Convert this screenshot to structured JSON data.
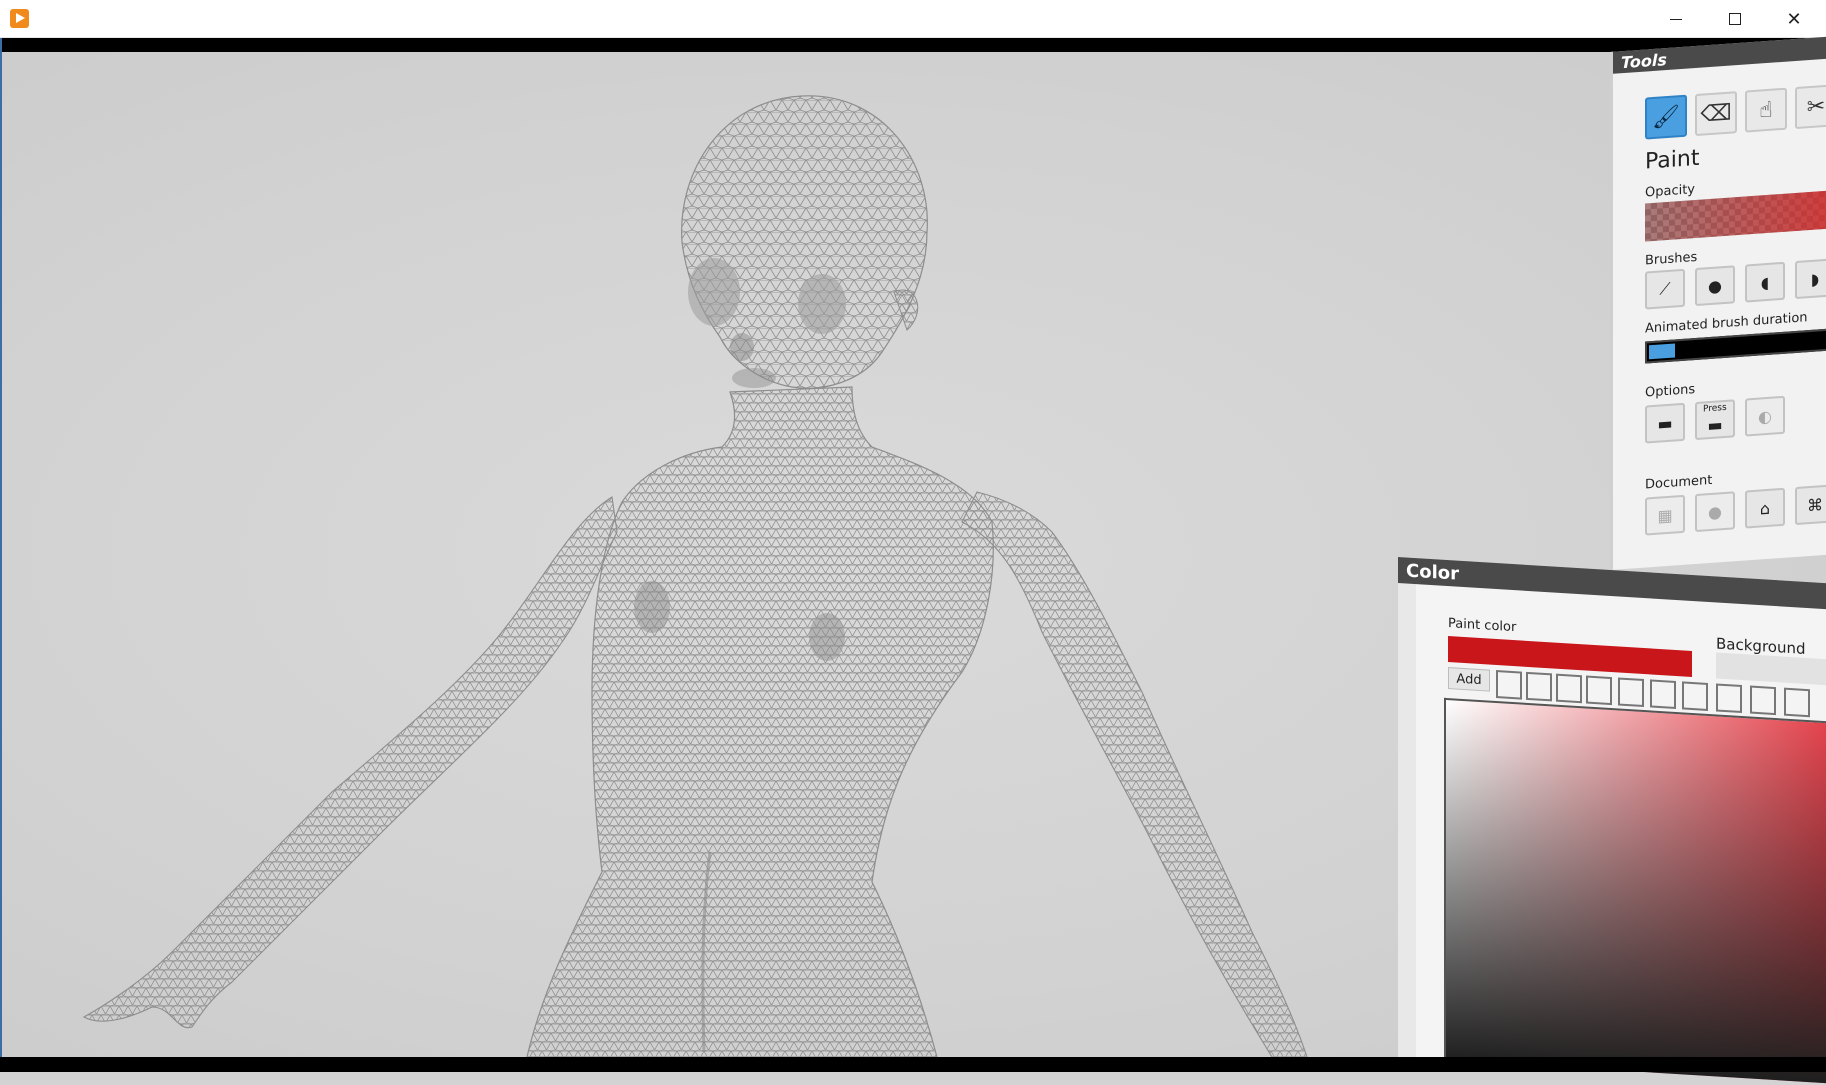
{
  "window": {
    "app_icon": "play-app-icon",
    "controls": {
      "minimize": "minimize-icon",
      "maximize": "maximize-icon",
      "close": "close-icon"
    }
  },
  "viewport": {
    "subject": "wireframe-humanoid-mesh",
    "background": "#d3d3d3",
    "mesh_color": "#8f8f8f"
  },
  "tools_panel": {
    "title": "Tools",
    "tools": [
      {
        "name": "brush-icon",
        "active": true
      },
      {
        "name": "eraser-icon",
        "active": false
      },
      {
        "name": "smudge-icon",
        "active": false
      },
      {
        "name": "cut-icon",
        "active": false
      }
    ],
    "mode_label": "Paint",
    "opacity_label": "Opacity",
    "brushes_label": "Brushes",
    "brushes": [
      "line-brush-icon",
      "round-brush-icon",
      "soft-brush-icon",
      "flat-brush-icon"
    ],
    "duration_label": "Animated brush duration",
    "duration_value": 0.15,
    "options_label": "Options",
    "options": [
      "line-option-icon",
      "pressure-option-icon",
      "symmetry-option-icon"
    ],
    "press_label": "Press",
    "document_label": "Document",
    "document": [
      "uv-grid-icon",
      "sphere-icon",
      "home-icon",
      "save-icon"
    ]
  },
  "color_panel": {
    "title": "Color",
    "paint_color_label": "Paint color",
    "paint_color": "#c8161a",
    "background_color_label": "Background co",
    "background_color": "#e2e2e2",
    "add_label": "Add",
    "slot_count": 10,
    "picker_hue": "#e23a44"
  },
  "colors": {
    "accent": "#4a9fe0",
    "header": "#4a4a4a"
  }
}
